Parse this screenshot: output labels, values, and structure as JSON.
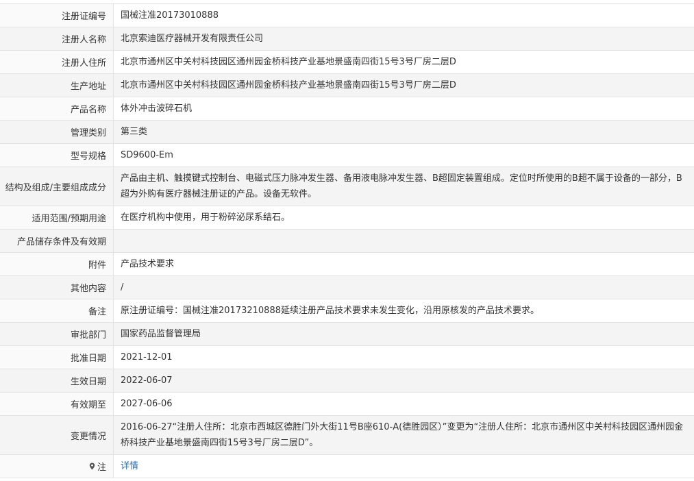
{
  "rows": [
    {
      "label": "注册证编号",
      "value": "国械注准20173010888"
    },
    {
      "label": "注册人名称",
      "value": "北京索迪医疗器械开发有限责任公司"
    },
    {
      "label": "注册人住所",
      "value": "北京市通州区中关村科技园区通州园金桥科技产业基地景盛南四街15号3号厂房二层D"
    },
    {
      "label": "生产地址",
      "value": "北京市通州区中关村科技园区通州园金桥科技产业基地景盛南四街15号3号厂房二层D"
    },
    {
      "label": "产品名称",
      "value": "体外冲击波碎石机"
    },
    {
      "label": "管理类别",
      "value": "第三类"
    },
    {
      "label": "型号规格",
      "value": "SD9600-Em"
    },
    {
      "label": "结构及组成/主要组成成分",
      "value": "产品由主机、触摸键式控制台、电磁式压力脉冲发生器、备用液电脉冲发生器、B超固定装置组成。定位时所使用的B超不属于设备的一部分，B超为外购有医疗器械注册证的产品。设备无软件。"
    },
    {
      "label": "适用范围/预期用途",
      "value": "在医疗机构中使用，用于粉碎泌尿系结石。"
    },
    {
      "label": "产品储存条件及有效期",
      "value": ""
    },
    {
      "label": "附件",
      "value": "产品技术要求"
    },
    {
      "label": "其他内容",
      "value": "/"
    },
    {
      "label": "备注",
      "value": "原注册证编号：国械注准20173210888延续注册产品技术要求未发生变化，沿用原核发的产品技术要求。"
    },
    {
      "label": "审批部门",
      "value": "国家药品监督管理局"
    },
    {
      "label": "批准日期",
      "value": "2021-12-01"
    },
    {
      "label": "生效日期",
      "value": "2022-06-07"
    },
    {
      "label": "有效期至",
      "value": "2027-06-06"
    },
    {
      "label": "变更情况",
      "value": "2016-06-27“注册人住所：北京市西城区德胜门外大街11号B座610-A(德胜园区）”变更为“注册人住所：北京市通州区中关村科技园区通州园金桥科技产业基地景盛南四街15号3号厂房二层D”。"
    },
    {
      "label": "注",
      "value": "详情"
    }
  ],
  "icons": {
    "note": "location-pin-icon"
  }
}
